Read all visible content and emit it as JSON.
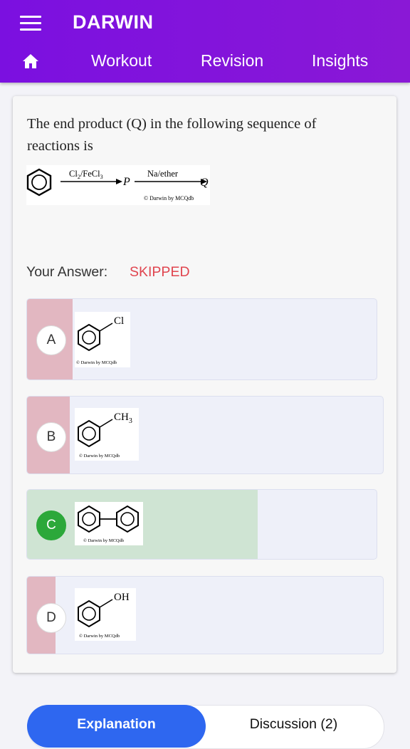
{
  "app": {
    "title": "DARWIN"
  },
  "nav": {
    "tabs": [
      "Workout",
      "Revision",
      "Insights"
    ]
  },
  "question": {
    "text": "The end product (Q) in the following sequence of reactions is",
    "reaction": {
      "reagent1": "Cl2/FeCl3",
      "intermediate": "P",
      "reagent2": "Na/ether",
      "product": "Q",
      "watermark": "© Darwin by MCQdb"
    }
  },
  "answer": {
    "label": "Your Answer:",
    "value": "SKIPPED"
  },
  "options": [
    {
      "letter": "A",
      "substituent": "Cl",
      "watermark": "© Darwin by MCQdb"
    },
    {
      "letter": "B",
      "substituent": "CH3",
      "watermark": "© Darwin by MCQdb"
    },
    {
      "letter": "C",
      "substituent": "biphenyl",
      "watermark": "© Darwin by MCQdb"
    },
    {
      "letter": "D",
      "substituent": "OH",
      "watermark": "© Darwin by MCQdb"
    }
  ],
  "footer": {
    "explanation_label": "Explanation",
    "discussion_label": "Discussion (2)"
  },
  "colors": {
    "appbar": "#7b10e0",
    "skipped": "#e0454f",
    "wrong_strip": "#e2b7c1",
    "correct_fill": "#cfe4d3",
    "correct_badge": "#2ca83a",
    "primary_button": "#2e67f0"
  }
}
